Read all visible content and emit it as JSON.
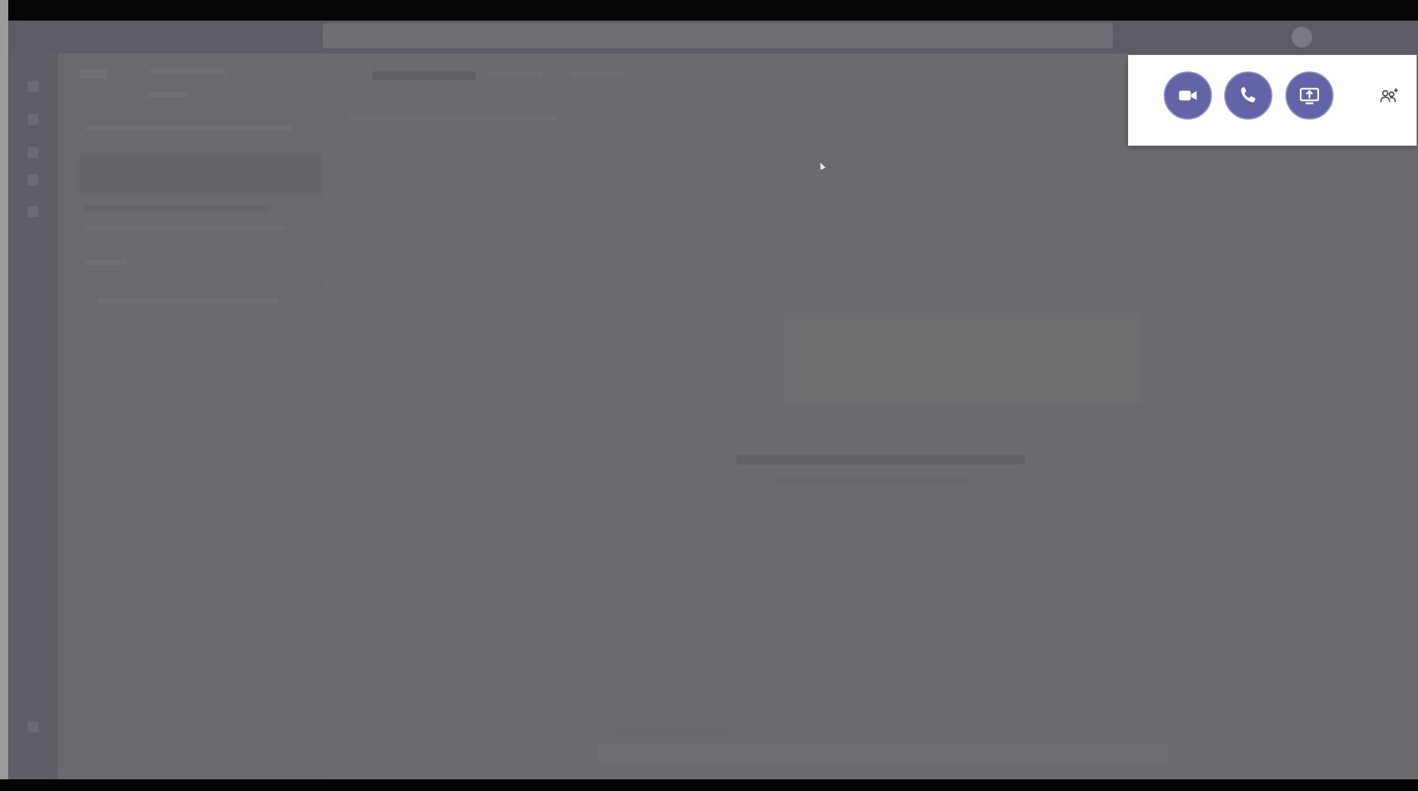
{
  "window": {
    "title": ""
  },
  "call_controls": {
    "buttons": [
      {
        "id": "video-call",
        "icon": "video-camera-icon"
      },
      {
        "id": "audio-call",
        "icon": "phone-icon"
      },
      {
        "id": "share-screen",
        "icon": "share-screen-icon"
      },
      {
        "id": "add-people",
        "icon": "add-people-icon"
      }
    ]
  },
  "colors": {
    "accent": "#6264a7",
    "overlay": "#6b6a6f",
    "popup_bg": "#ffffff"
  }
}
